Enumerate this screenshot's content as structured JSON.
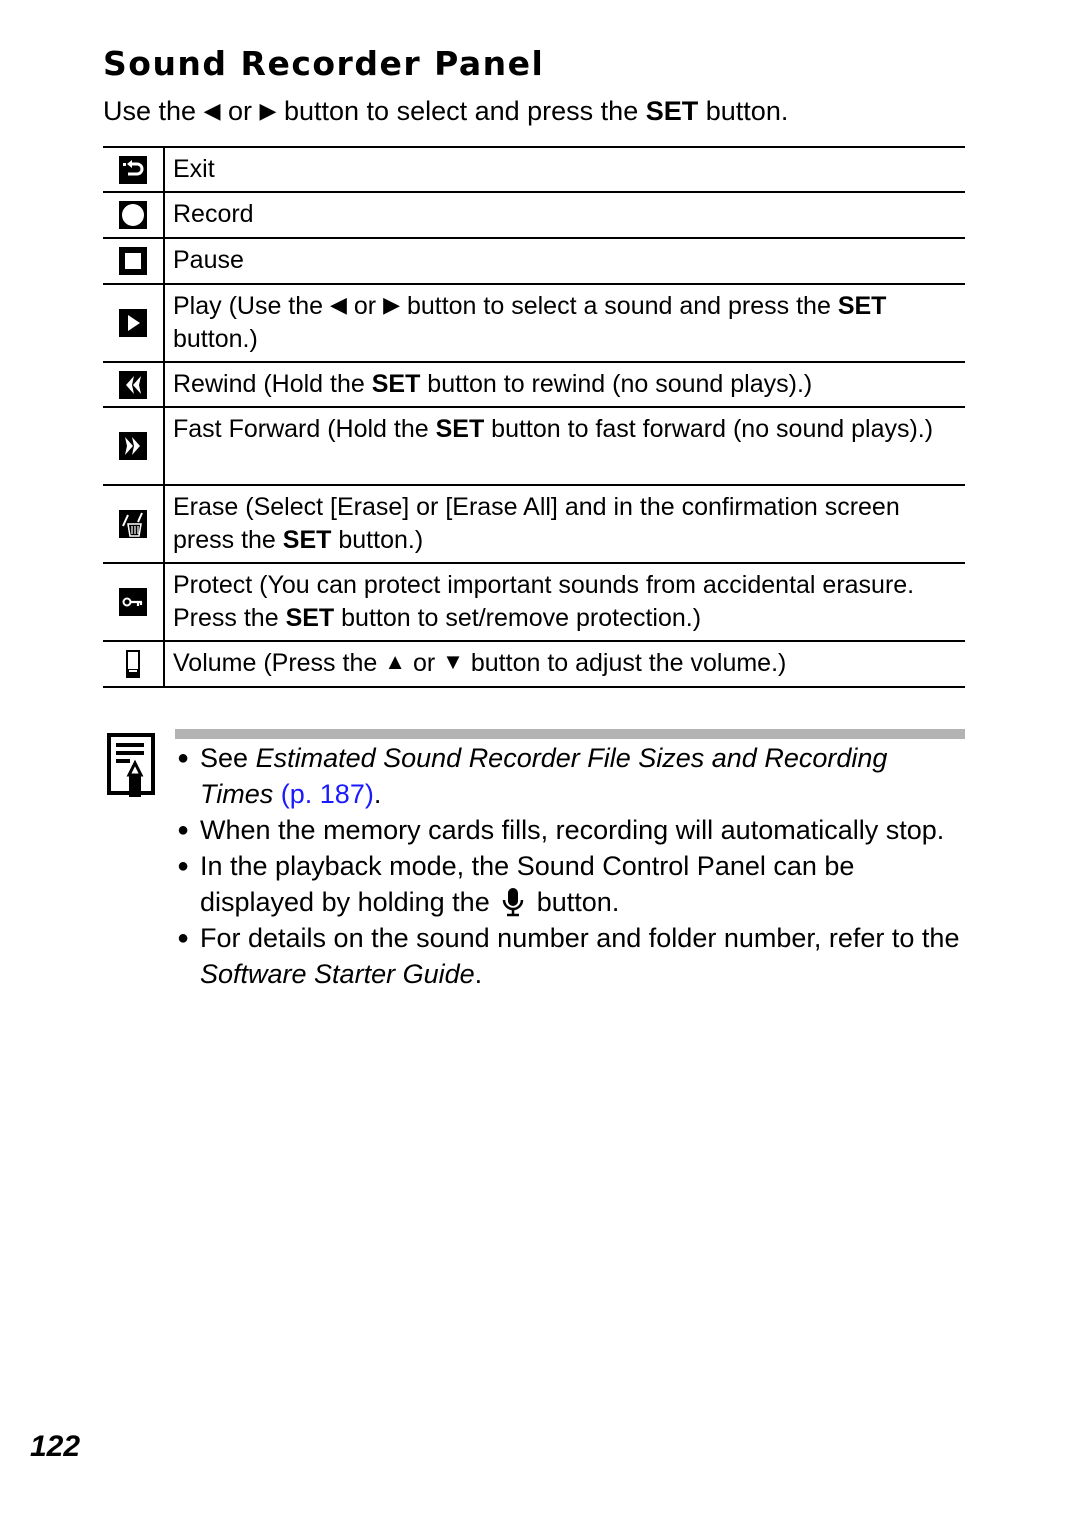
{
  "page": {
    "title": "Sound Recorder Panel",
    "intro": {
      "part1": "Use the",
      "left_arrow": "◀",
      "or": "or",
      "right_arrow": "▶",
      "part2": "button to select and press the",
      "set": "SET",
      "part3": "button."
    },
    "page_number": "122"
  },
  "table": {
    "rows": [
      {
        "icon": "exit-icon",
        "text": "Exit"
      },
      {
        "icon": "record-icon",
        "text": "Record"
      },
      {
        "icon": "pause-icon",
        "text": "Pause"
      },
      {
        "icon": "play-icon",
        "pre": "Play (Use the",
        "left_arrow": "◀",
        "or": "or",
        "right_arrow": "▶",
        "mid": "button to select a sound and press the",
        "set": "SET",
        "post": "button.)"
      },
      {
        "icon": "rewind-icon",
        "pre": "Rewind (Hold the",
        "set": "SET",
        "post": "button to rewind (no sound plays).)"
      },
      {
        "icon": "fast-forward-icon",
        "pre": "Fast Forward (Hold the",
        "set": "SET",
        "post": "button to fast forward (no sound plays).)"
      },
      {
        "icon": "erase-icon",
        "pre": "Erase (Select [Erase] or [Erase All] and in the confirmation screen press the",
        "set": "SET",
        "post": "button.)"
      },
      {
        "icon": "protect-icon",
        "pre": "Protect (You can protect important sounds from accidental erasure. Press the",
        "set": "SET",
        "post": "button to set/remove protection.)"
      },
      {
        "icon": "volume-icon",
        "pre": "Volume (Press the",
        "up_arrow": "▲",
        "or": "or",
        "down_arrow": "▼",
        "post": "button to adjust the volume.)"
      }
    ]
  },
  "notes": {
    "bullet": "●",
    "items": [
      {
        "pre": "See",
        "italic": "Estimated Sound Recorder File Sizes and Recording Times",
        "link": "(p. 187)",
        "post": "."
      },
      {
        "text": "When the memory cards fills, recording will automatically stop."
      },
      {
        "pre": "In the playback mode, the Sound Control Panel can be displayed by holding the",
        "icon": "microphone-icon",
        "post": "button."
      },
      {
        "pre": "For details on the sound number and folder number, refer to the",
        "italic": "Software Starter Guide",
        "post": "."
      }
    ]
  },
  "colors": {
    "link": "#1a1aff",
    "note_bar": "#b3b3b3"
  }
}
